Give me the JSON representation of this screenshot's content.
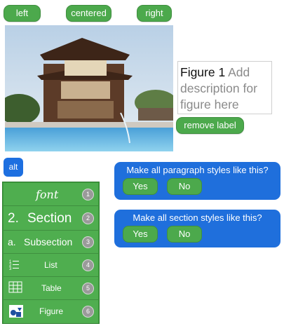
{
  "alignment": {
    "left_label": "left",
    "centered_label": "centered",
    "right_label": "right"
  },
  "figure": {
    "caption_prefix": "Figure 1",
    "caption_placeholder": "Add description for figure here",
    "remove_label": "remove label"
  },
  "alt_label": "alt",
  "styles_menu": {
    "items": [
      {
        "label": "font",
        "number": "1",
        "icon": "font"
      },
      {
        "label": "Section",
        "prefix": "2.",
        "number": "2"
      },
      {
        "label": "Subsection",
        "prefix": "a.",
        "number": "3"
      },
      {
        "label": "List",
        "number": "4",
        "icon": "list-icon"
      },
      {
        "label": "Table",
        "number": "5",
        "icon": "table-icon"
      },
      {
        "label": "Figure",
        "number": "6",
        "icon": "figure-icon"
      }
    ]
  },
  "paragraph_prompt": {
    "question": "Make all paragraph styles like this?",
    "yes_label": "Yes",
    "no_label": "No"
  },
  "section_prompt": {
    "question": "Make all section styles like this?",
    "yes_label": "Yes",
    "no_label": "No"
  },
  "colors": {
    "green": "#4ca94c",
    "blue": "#1f6fdc"
  }
}
